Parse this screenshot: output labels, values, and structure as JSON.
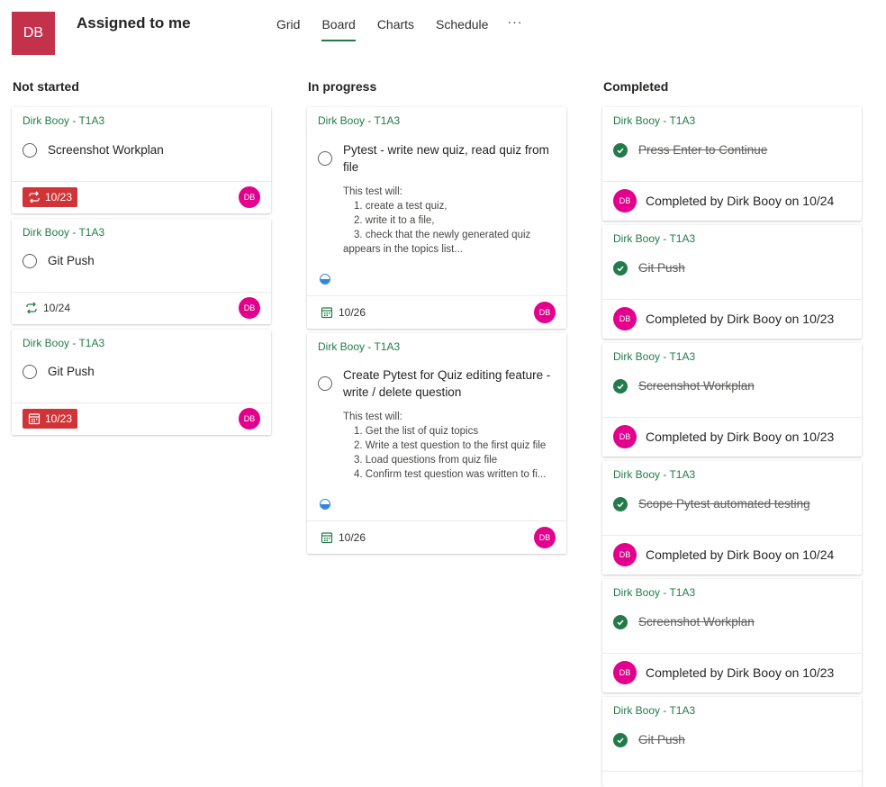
{
  "header": {
    "avatar_initials": "DB",
    "title": "Assigned to me",
    "tabs": [
      {
        "label": "Grid",
        "active": false
      },
      {
        "label": "Board",
        "active": true
      },
      {
        "label": "Charts",
        "active": false
      },
      {
        "label": "Schedule",
        "active": false
      }
    ],
    "more_label": "···"
  },
  "colors": {
    "accent_green": "#237b4b",
    "avatar_header": "#c4314b",
    "avatar_user": "#e3008c",
    "overdue_red": "#d13438",
    "progress_blue": "#2b88d8"
  },
  "columns": {
    "not_started": {
      "title": "Not started",
      "cards": [
        {
          "bucket": "Dirk Booy - T1A3",
          "title": "Screenshot Workplan",
          "date": "10/23",
          "date_icon": "repeat-icon",
          "overdue": true,
          "assignee": "DB"
        },
        {
          "bucket": "Dirk Booy - T1A3",
          "title": "Git Push",
          "date": "10/24",
          "date_icon": "repeat-icon",
          "overdue": false,
          "assignee": "DB"
        },
        {
          "bucket": "Dirk Booy - T1A3",
          "title": "Git Push",
          "date": "10/23",
          "date_icon": "calendar-icon",
          "overdue": true,
          "assignee": "DB"
        }
      ]
    },
    "in_progress": {
      "title": "In progress",
      "cards": [
        {
          "bucket": "Dirk Booy - T1A3",
          "title": "Pytest - write new quiz, read quiz from file",
          "desc_intro": "This test will:",
          "desc_items": [
            "1. create a test quiz,",
            "2. write it to a file,",
            "3. check that the newly generated quiz"
          ],
          "desc_tail": "appears in the topics list...",
          "progress": 0.5,
          "date": "10/26",
          "date_icon": "calendar-icon",
          "assignee": "DB"
        },
        {
          "bucket": "Dirk Booy - T1A3",
          "title": "Create Pytest for Quiz editing feature - write / delete question",
          "desc_intro": "This test will:",
          "desc_items": [
            "1. Get the list of quiz topics",
            "2. Write a test question to the first quiz file",
            "3. Load questions from quiz file",
            "4. Confirm test question was written to fi..."
          ],
          "desc_tail": "",
          "progress": 0.5,
          "date": "10/26",
          "date_icon": "calendar-icon",
          "assignee": "DB"
        }
      ]
    },
    "completed": {
      "title": "Completed",
      "cards": [
        {
          "bucket": "Dirk Booy - T1A3",
          "title": "Press Enter to Continue",
          "assignee": "DB",
          "completed_text": "Completed by Dirk Booy on 10/24"
        },
        {
          "bucket": "Dirk Booy - T1A3",
          "title": "Git Push",
          "assignee": "DB",
          "completed_text": "Completed by Dirk Booy on 10/23"
        },
        {
          "bucket": "Dirk Booy - T1A3",
          "title": "Screenshot Workplan",
          "assignee": "DB",
          "completed_text": "Completed by Dirk Booy on 10/23"
        },
        {
          "bucket": "Dirk Booy - T1A3",
          "title": "Scope Pytest automated testing",
          "assignee": "DB",
          "completed_text": "Completed by Dirk Booy on 10/24"
        },
        {
          "bucket": "Dirk Booy - T1A3",
          "title": "Screenshot Workplan",
          "assignee": "DB",
          "completed_text": "Completed by Dirk Booy on 10/23"
        },
        {
          "bucket": "Dirk Booy - T1A3",
          "title": "Git Push",
          "assignee": "DB",
          "completed_text": ""
        }
      ]
    }
  }
}
